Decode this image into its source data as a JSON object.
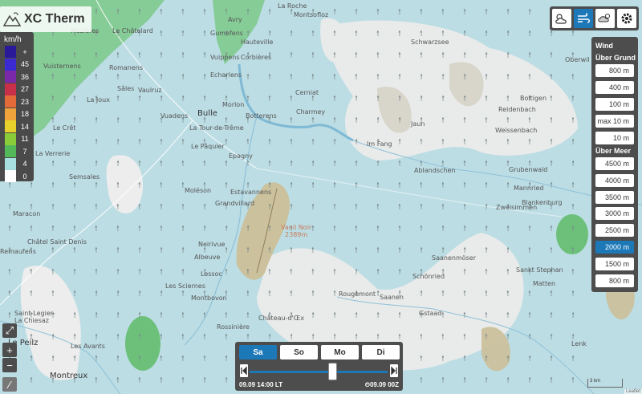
{
  "app": {
    "title": "XC Therm"
  },
  "legend": {
    "unit": "km/h",
    "rows": [
      {
        "label": "+",
        "color": "#2a1a9a"
      },
      {
        "label": "45",
        "color": "#3a2ad0"
      },
      {
        "label": "36",
        "color": "#7a2aa8"
      },
      {
        "label": "27",
        "color": "#c8304a"
      },
      {
        "label": "23",
        "color": "#e56a3a"
      },
      {
        "label": "18",
        "color": "#f0a33a"
      },
      {
        "label": "14",
        "color": "#e8d02a"
      },
      {
        "label": "11",
        "color": "#8acb3a"
      },
      {
        "label": "7",
        "color": "#53b85a"
      },
      {
        "label": "4",
        "color": "#a8dfe0"
      },
      {
        "label": "0",
        "color": "#ffffff"
      }
    ]
  },
  "toolbar": {
    "icons": [
      "cloud-sun-icon",
      "wind-icon",
      "thermals-icon",
      "gear-icon"
    ],
    "active_index": 1
  },
  "wind_panel": {
    "title": "Wind",
    "ground_title": "Über Grund",
    "ground_levels": [
      "800 m",
      "400 m",
      "100 m",
      "max 10 m",
      "10 m"
    ],
    "sea_title": "Über Meer",
    "sea_levels": [
      "4500 m",
      "4000 m",
      "3500 m",
      "3000 m",
      "2500 m",
      "2000 m",
      "1500 m",
      "800 m"
    ],
    "active_sea_level": "2000 m"
  },
  "controls": {
    "fullscreen": "⤢",
    "zoom_in": "+",
    "zoom_out": "−",
    "draw": "⁄"
  },
  "time_panel": {
    "days": [
      "Sa",
      "So",
      "Mo",
      "Di"
    ],
    "active_day": "Sa",
    "slider_fraction": 0.6,
    "current_time": "09.09 14:00 LT",
    "model_run": "⏲09.09 00Z"
  },
  "scale": {
    "label": "3 km"
  },
  "attribution": "Leaflet",
  "places": [
    {
      "name": "La Roche",
      "cls": ""
    },
    {
      "name": "Montsofloz",
      "cls": ""
    },
    {
      "name": "Mézières",
      "cls": ""
    },
    {
      "name": "Le Châtelard",
      "cls": ""
    },
    {
      "name": "Avry",
      "cls": ""
    },
    {
      "name": "Gumefens",
      "cls": ""
    },
    {
      "name": "Hauteville",
      "cls": ""
    },
    {
      "name": "Schwarzsee",
      "cls": ""
    },
    {
      "name": "Oberwil",
      "cls": ""
    },
    {
      "name": "Vuippens",
      "cls": ""
    },
    {
      "name": "Corbières",
      "cls": ""
    },
    {
      "name": "Vuisternens",
      "cls": ""
    },
    {
      "name": "Romanens",
      "cls": ""
    },
    {
      "name": "Echarlens",
      "cls": ""
    },
    {
      "name": "Sâles",
      "cls": ""
    },
    {
      "name": "La Joux",
      "cls": ""
    },
    {
      "name": "Vaulruz",
      "cls": ""
    },
    {
      "name": "Bulle",
      "cls": "town"
    },
    {
      "name": "Morlon",
      "cls": ""
    },
    {
      "name": "Cerniat",
      "cls": ""
    },
    {
      "name": "Boltigen",
      "cls": ""
    },
    {
      "name": "Reidenbach",
      "cls": ""
    },
    {
      "name": "Vuadens",
      "cls": ""
    },
    {
      "name": "Botterens",
      "cls": ""
    },
    {
      "name": "Charmey",
      "cls": ""
    },
    {
      "name": "Jaun",
      "cls": ""
    },
    {
      "name": "Le Crêt",
      "cls": ""
    },
    {
      "name": "La Tour-de-Trême",
      "cls": ""
    },
    {
      "name": "Weissenbach",
      "cls": ""
    },
    {
      "name": "Im Fang",
      "cls": ""
    },
    {
      "name": "Le Pâquier",
      "cls": ""
    },
    {
      "name": "La Verrerie",
      "cls": ""
    },
    {
      "name": "Epagny",
      "cls": ""
    },
    {
      "name": "Grubenwald",
      "cls": ""
    },
    {
      "name": "Semsales",
      "cls": ""
    },
    {
      "name": "Ablandschen",
      "cls": ""
    },
    {
      "name": "Estavannens",
      "cls": ""
    },
    {
      "name": "Moléson",
      "cls": ""
    },
    {
      "name": "Mannried",
      "cls": ""
    },
    {
      "name": "Maracon",
      "cls": ""
    },
    {
      "name": "Zweisimmen",
      "cls": ""
    },
    {
      "name": "Grandvillard",
      "cls": ""
    },
    {
      "name": "Blankenburg",
      "cls": ""
    },
    {
      "name": "Vanil Noir\n2389m",
      "cls": "peak"
    },
    {
      "name": "Châtel Saint Denis",
      "cls": ""
    },
    {
      "name": "Neirivue",
      "cls": ""
    },
    {
      "name": "Saanenmöser",
      "cls": ""
    },
    {
      "name": "Albeuve",
      "cls": ""
    },
    {
      "name": "Sankt Stephan",
      "cls": ""
    },
    {
      "name": "Remaufens",
      "cls": ""
    },
    {
      "name": "Lessoc",
      "cls": ""
    },
    {
      "name": "Schönried",
      "cls": ""
    },
    {
      "name": "Matten",
      "cls": ""
    },
    {
      "name": "Les Sciernes",
      "cls": ""
    },
    {
      "name": "Rougemont",
      "cls": ""
    },
    {
      "name": "Saanen",
      "cls": ""
    },
    {
      "name": "Montbovon",
      "cls": ""
    },
    {
      "name": "Gstaad",
      "cls": ""
    },
    {
      "name": "Saint-Legier-\nLa Chiesaz",
      "cls": ""
    },
    {
      "name": "Château-d'Œx",
      "cls": ""
    },
    {
      "name": "Rossinière",
      "cls": ""
    },
    {
      "name": "Le Peilz",
      "cls": "town"
    },
    {
      "name": "Les Avants",
      "cls": ""
    },
    {
      "name": "Lenk",
      "cls": ""
    },
    {
      "name": "Montreux",
      "cls": "town"
    }
  ]
}
